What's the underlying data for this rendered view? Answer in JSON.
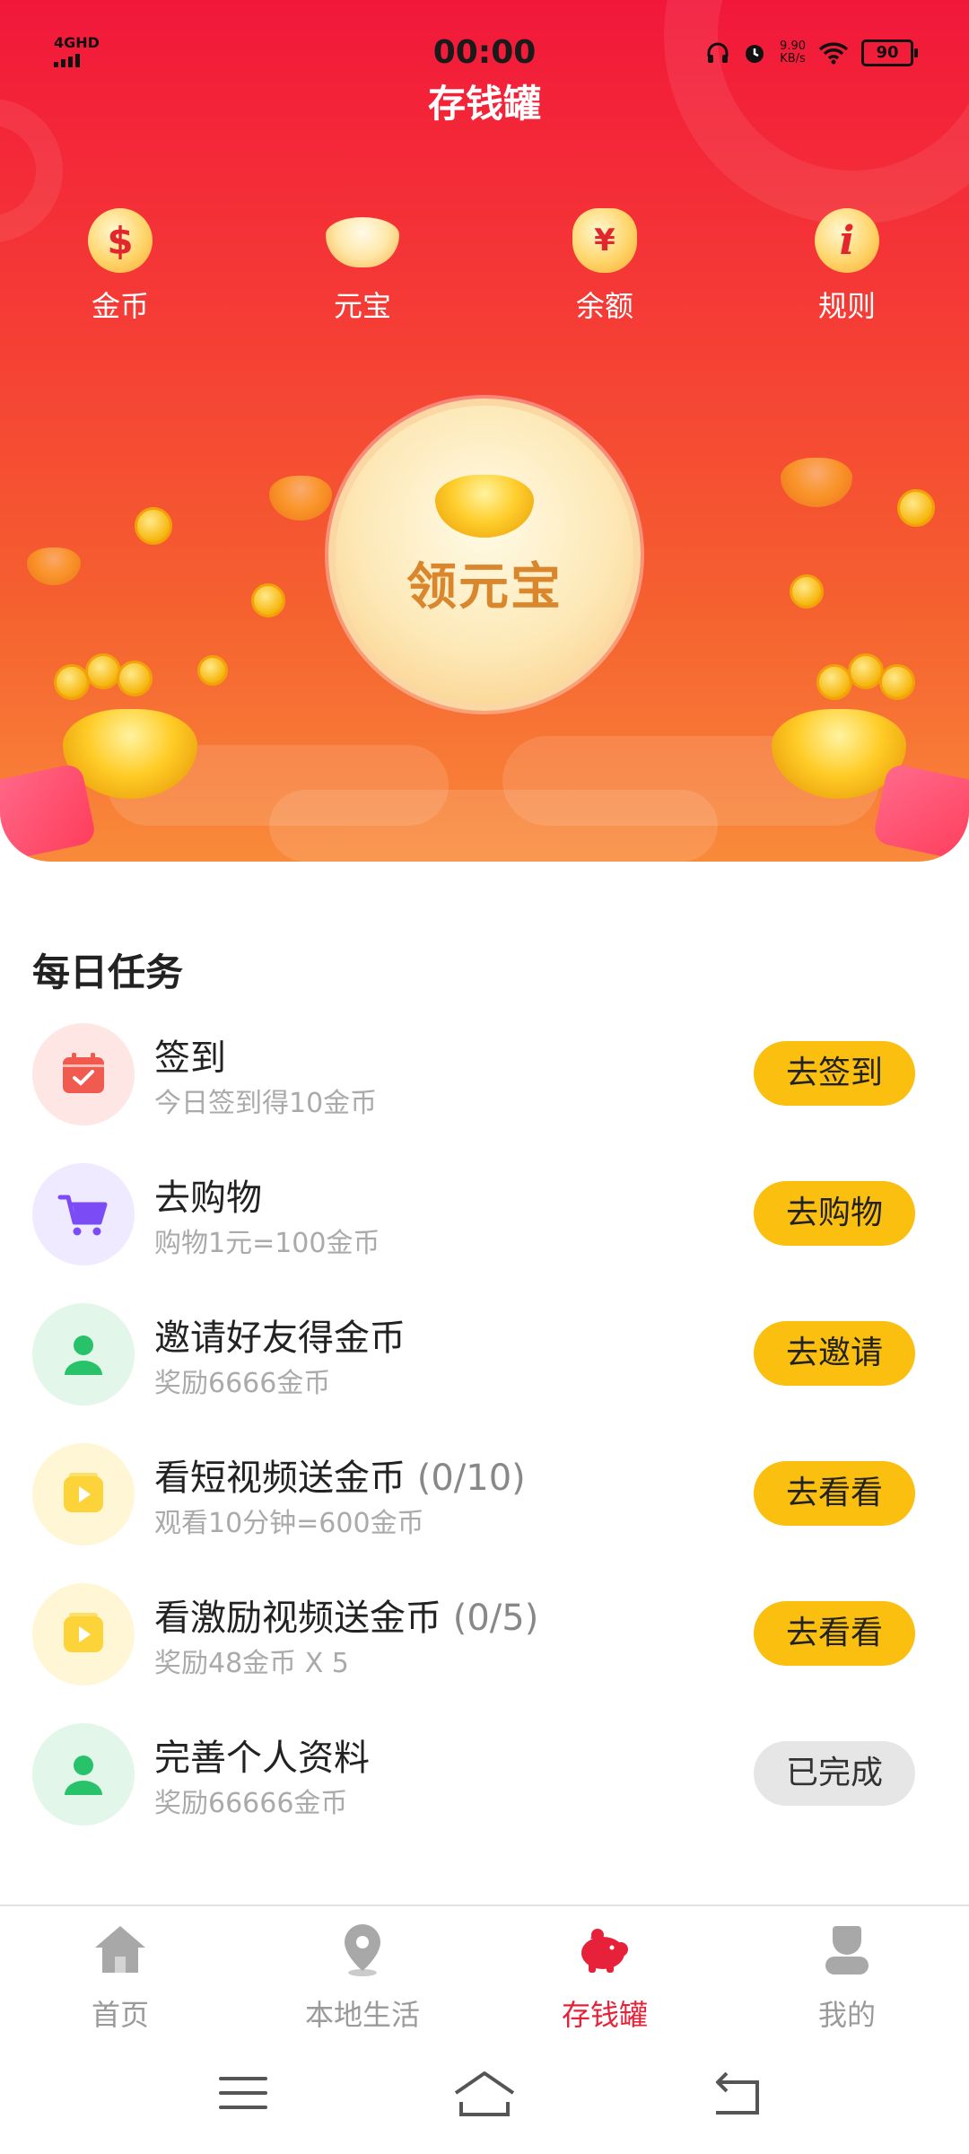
{
  "status_bar": {
    "network": "4GHD",
    "time": "00:00",
    "speed_value": "9.90",
    "speed_unit": "KB/s",
    "battery": "90"
  },
  "header": {
    "title": "存钱罐"
  },
  "quick_nav": [
    {
      "label": "金币",
      "icon": "dollar-coin-icon"
    },
    {
      "label": "元宝",
      "icon": "gold-ingot-icon"
    },
    {
      "label": "余额",
      "icon": "money-bag-icon"
    },
    {
      "label": "规则",
      "icon": "info-icon"
    }
  ],
  "claim_button": {
    "label": "领元宝"
  },
  "tasks_section": {
    "title": "每日任务",
    "items": [
      {
        "name": "签到",
        "progress": "",
        "desc": "今日签到得10金币",
        "button": "去签到",
        "status": "pending",
        "icon": "calendar-check-icon"
      },
      {
        "name": "去购物",
        "progress": "",
        "desc": "购物1元=100金币",
        "button": "去购物",
        "status": "pending",
        "icon": "shopping-cart-icon"
      },
      {
        "name": "邀请好友得金币",
        "progress": "",
        "desc": "奖励6666金币",
        "button": "去邀请",
        "status": "pending",
        "icon": "user-icon"
      },
      {
        "name": "看短视频送金币",
        "progress": "(0/10)",
        "desc": "观看10分钟=600金币",
        "button": "去看看",
        "status": "pending",
        "icon": "video-play-icon"
      },
      {
        "name": "看激励视频送金币",
        "progress": "(0/5)",
        "desc": "奖励48金币 X 5",
        "button": "去看看",
        "status": "pending",
        "icon": "video-play-icon"
      },
      {
        "name": "完善个人资料",
        "progress": "",
        "desc": "奖励66666金币",
        "button": "已完成",
        "status": "done",
        "icon": "user-icon"
      }
    ]
  },
  "tab_bar": {
    "active_index": 2,
    "items": [
      {
        "label": "首页",
        "icon": "home-icon"
      },
      {
        "label": "本地生活",
        "icon": "location-pin-icon"
      },
      {
        "label": "存钱罐",
        "icon": "piggy-bank-icon"
      },
      {
        "label": "我的",
        "icon": "profile-icon"
      }
    ]
  },
  "colors": {
    "brand_red": "#e8213a",
    "button_yellow": "#fbbf10",
    "done_gray": "#e6e6e6"
  }
}
